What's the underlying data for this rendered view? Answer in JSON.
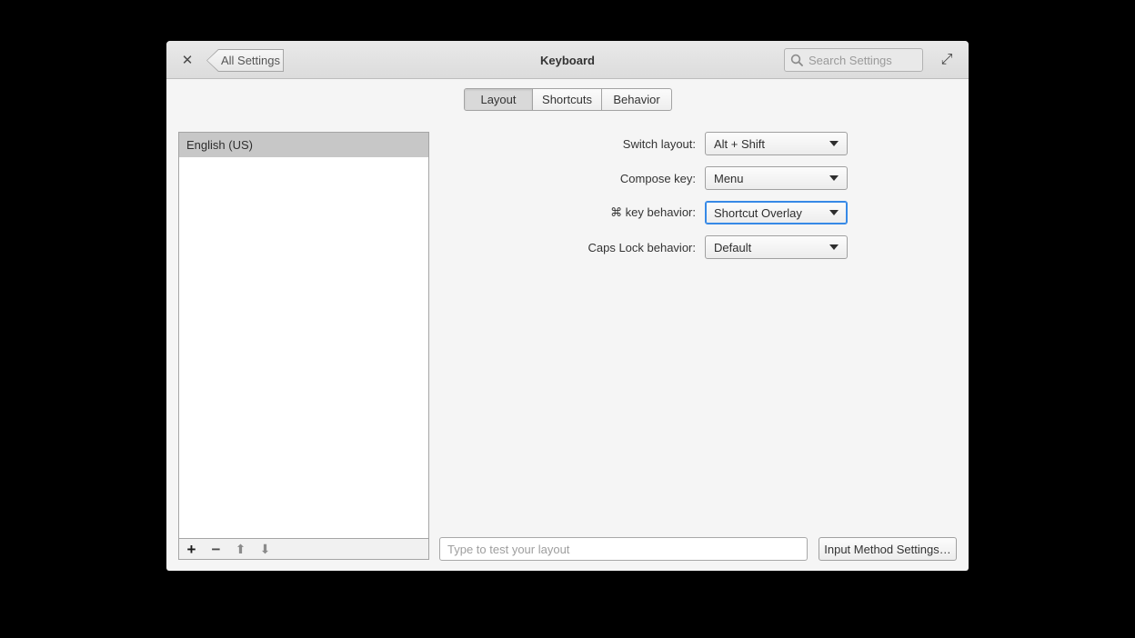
{
  "window": {
    "title": "Keyboard",
    "close_glyph": "✕",
    "back_label": "All Settings",
    "maximize_glyph": "⤢",
    "search": {
      "placeholder": "Search Settings"
    }
  },
  "tabs": [
    {
      "label": "Layout",
      "active": true
    },
    {
      "label": "Shortcuts",
      "active": false
    },
    {
      "label": "Behavior",
      "active": false
    }
  ],
  "layout_list": {
    "items": [
      {
        "label": "English (US)",
        "selected": true
      }
    ],
    "toolbar": {
      "add_glyph": "+",
      "remove_glyph": "−",
      "up_glyph": "⬆",
      "down_glyph": "⬇"
    }
  },
  "options": [
    {
      "label": "Switch layout:",
      "value": "Alt + Shift",
      "focused": false
    },
    {
      "label": "Compose key:",
      "value": "Menu",
      "focused": false
    },
    {
      "label": "⌘ key behavior:",
      "value": "Shortcut Overlay",
      "focused": true
    },
    {
      "label": "Caps Lock behavior:",
      "value": "Default",
      "focused": false
    }
  ],
  "footer": {
    "test_placeholder": "Type to test your layout",
    "input_method_button": "Input Method Settings…"
  },
  "colors": {
    "accent": "#3689e6",
    "headerbar": "#e4e4e4",
    "content_bg": "#f5f5f5",
    "selected_row": "#c7c7c7",
    "desktop_bg": "#000000"
  }
}
